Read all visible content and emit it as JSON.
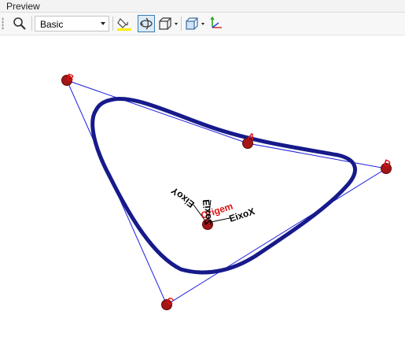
{
  "panel": {
    "title": "Preview"
  },
  "toolbar": {
    "items": [
      {
        "icon": "magnifier-icon"
      },
      {
        "display_style": "Basic"
      },
      {
        "icon": "paint-bucket-icon",
        "accent": "#ffee00"
      },
      {
        "icon": "rotate-view-icon",
        "active": true
      },
      {
        "icon": "box-view-icon"
      },
      {
        "icon": "view-cube-icon"
      },
      {
        "icon": "axes-icon"
      }
    ]
  },
  "scene": {
    "points": [
      {
        "label": "B"
      },
      {
        "label": "A"
      },
      {
        "label": "D"
      },
      {
        "label": "C"
      }
    ],
    "origin_label": "Origem",
    "axis_labels": {
      "x": "EixoX",
      "y": "EixoY",
      "z": "EixoZ"
    },
    "colors": {
      "curve": "#161a8a",
      "control_polygon": "#1d1de0",
      "point": "#a31616",
      "point_label": "#e01010",
      "axis_label": "#000000"
    }
  }
}
